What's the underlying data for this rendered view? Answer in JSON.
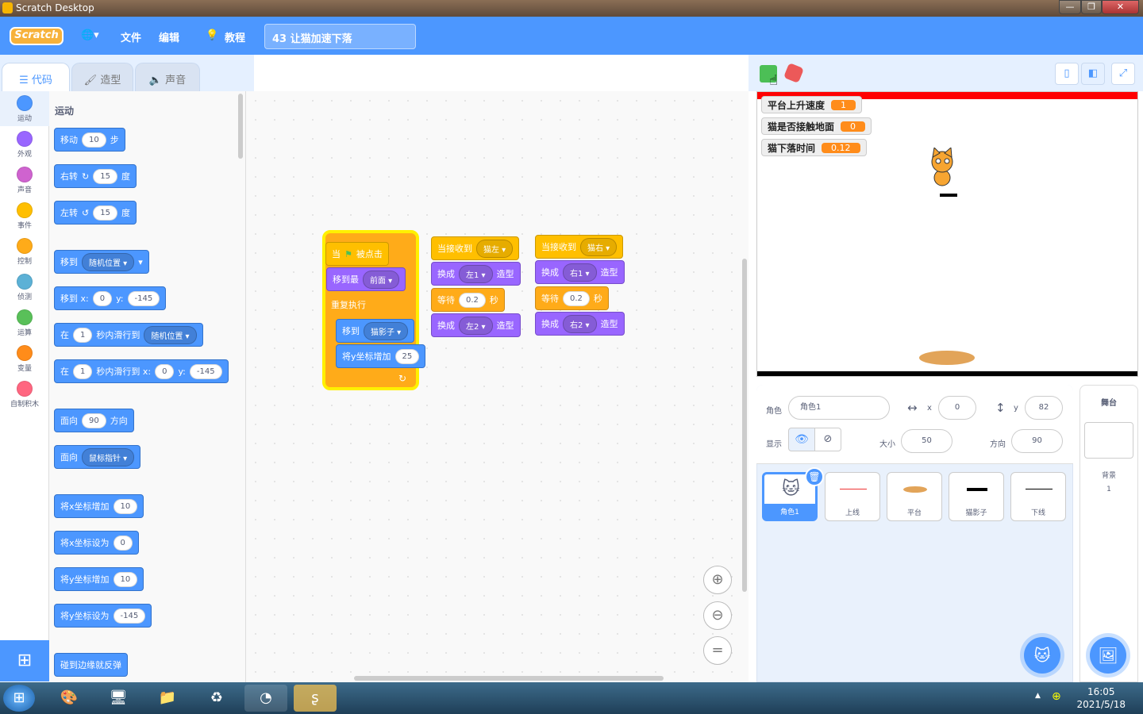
{
  "window": {
    "title": "Scratch Desktop",
    "min": "—",
    "max": "❐",
    "close": "✕"
  },
  "menu": {
    "logo": "Scratch",
    "globe": "🌐▾",
    "file": "文件",
    "edit": "编辑",
    "tutorial": "教程",
    "project_title": "43 让猫加速下落"
  },
  "tabs": {
    "code": "代码",
    "costume": "造型",
    "sound": "声音"
  },
  "categories": [
    {
      "label": "运动",
      "color": "#4c97ff"
    },
    {
      "label": "外观",
      "color": "#9966ff"
    },
    {
      "label": "声音",
      "color": "#cf63cf"
    },
    {
      "label": "事件",
      "color": "#ffbf00"
    },
    {
      "label": "控制",
      "color": "#ffab19"
    },
    {
      "label": "侦测",
      "color": "#5cb1d6"
    },
    {
      "label": "运算",
      "color": "#59c059"
    },
    {
      "label": "变量",
      "color": "#ff8c1a"
    },
    {
      "label": "自制积木",
      "color": "#ff6680"
    }
  ],
  "palette": {
    "heading": "运动",
    "move": {
      "a": "移动",
      "v": "10",
      "b": "步"
    },
    "turn_right": {
      "a": "右转",
      "v": "15",
      "b": "度"
    },
    "turn_left": {
      "a": "左转",
      "v": "15",
      "b": "度"
    },
    "goto": {
      "a": "移到",
      "dd": "随机位置"
    },
    "goto_xy": {
      "a": "移到 x:",
      "x": "0",
      "ylab": "y:",
      "y": "-145"
    },
    "glide": {
      "a": "在",
      "v": "1",
      "b": "秒内滑行到",
      "dd": "随机位置"
    },
    "glide_xy": {
      "a": "在",
      "v": "1",
      "b": "秒内滑行到 x:",
      "x": "0",
      "ylab": "y:",
      "y": "-145"
    },
    "point_dir": {
      "a": "面向",
      "v": "90",
      "b": "方向"
    },
    "point_towards": {
      "a": "面向",
      "dd": "鼠标指针"
    },
    "change_x": {
      "a": "将x坐标增加",
      "v": "10"
    },
    "set_x": {
      "a": "将x坐标设为",
      "v": "0"
    },
    "change_y": {
      "a": "将y坐标增加",
      "v": "10"
    },
    "set_y": {
      "a": "将y坐标设为",
      "v": "-145"
    },
    "bounce": {
      "a": "碰到边缘就反弹"
    }
  },
  "script1": {
    "hat_a": "当",
    "hat_b": "被点击",
    "front_a": "移到最",
    "front_dd": "前面",
    "forever": "重复执行",
    "goto_a": "移到",
    "goto_dd": "猫影子",
    "change_y_a": "将y坐标增加",
    "change_y_v": "25"
  },
  "script2": {
    "hat_a": "当接收到",
    "hat_dd": "猫左",
    "sw1_a": "换成",
    "sw1_dd": "左1",
    "sw1_b": "造型",
    "wait_a": "等待",
    "wait_v": "0.2",
    "wait_b": "秒",
    "sw2_a": "换成",
    "sw2_dd": "左2",
    "sw2_b": "造型"
  },
  "script3": {
    "hat_a": "当接收到",
    "hat_dd": "猫右",
    "sw1_a": "换成",
    "sw1_dd": "右1",
    "sw1_b": "造型",
    "wait_a": "等待",
    "wait_v": "0.2",
    "wait_b": "秒",
    "sw2_a": "换成",
    "sw2_dd": "右2",
    "sw2_b": "造型"
  },
  "monitors": [
    {
      "label": "平台上升速度",
      "value": "1"
    },
    {
      "label": "猫是否接触地面",
      "value": "0"
    },
    {
      "label": "猫下落时间",
      "value": "0.12"
    }
  ],
  "sprite_info": {
    "sprite_label": "角色",
    "sprite_name": "角色1",
    "x_label": "x",
    "x": "0",
    "y_label": "y",
    "y": "82",
    "show_label": "显示",
    "size_label": "大小",
    "size": "50",
    "dir_label": "方向",
    "dir": "90"
  },
  "sprites": [
    {
      "name": "角色1"
    },
    {
      "name": "上线"
    },
    {
      "name": "平台"
    },
    {
      "name": "猫影子"
    },
    {
      "name": "下线"
    }
  ],
  "stage_pane": {
    "title": "舞台",
    "backdrop_label": "背景",
    "backdrop_count": "1"
  },
  "taskbar": {
    "time": "16:05",
    "date": "2021/5/18"
  }
}
